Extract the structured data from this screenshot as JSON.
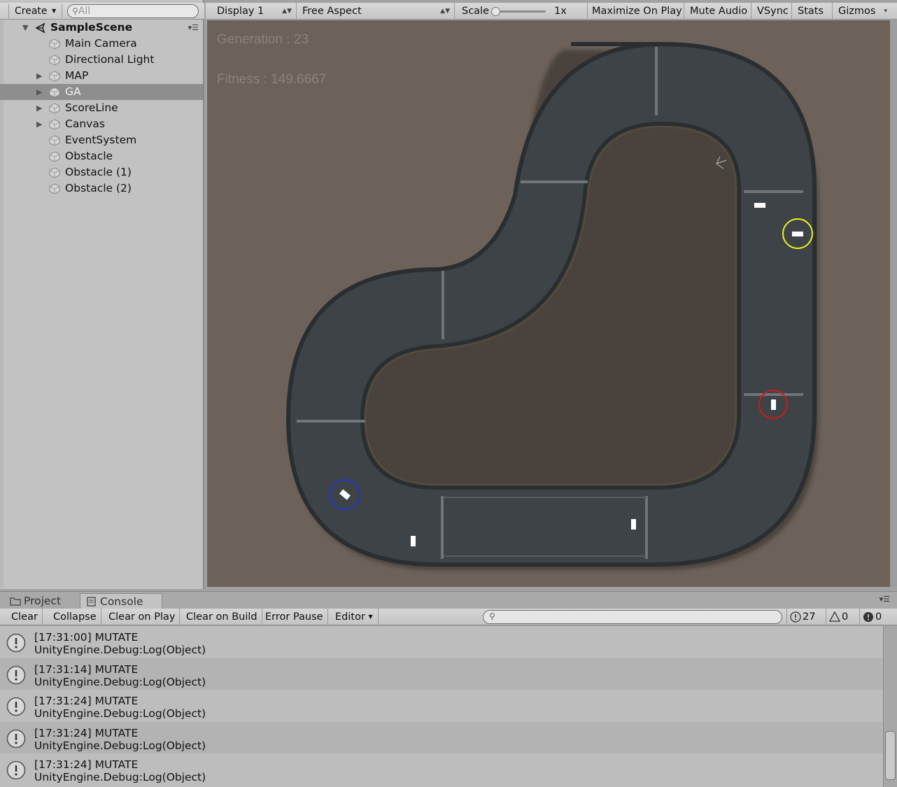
{
  "hierarchy": {
    "create_label": "Create",
    "search_placeholder": "All",
    "scene_name": "SampleScene",
    "items": [
      {
        "label": "Main Camera",
        "expandable": false
      },
      {
        "label": "Directional Light",
        "expandable": false
      },
      {
        "label": "MAP",
        "expandable": true
      },
      {
        "label": "GA",
        "expandable": true,
        "selected": true
      },
      {
        "label": "ScoreLine",
        "expandable": true
      },
      {
        "label": "Canvas",
        "expandable": true
      },
      {
        "label": "EventSystem",
        "expandable": false
      },
      {
        "label": "Obstacle",
        "expandable": false
      },
      {
        "label": "Obstacle (1)",
        "expandable": false
      },
      {
        "label": "Obstacle (2)",
        "expandable": false
      }
    ]
  },
  "game_toolbar": {
    "display": "Display 1",
    "aspect": "Free Aspect",
    "scale_label": "Scale",
    "scale_value": "1x",
    "maximize": "Maximize On Play",
    "mute": "Mute Audio",
    "vsync": "VSync",
    "stats": "Stats",
    "gizmos": "Gizmos"
  },
  "game_view": {
    "generation_text": "Generation : 23",
    "fitness_text": "Fitness : 149.6667",
    "colors": {
      "background": "#6c625a",
      "track": "#3d4347",
      "track_edge": "#2e3133",
      "highlight_yellow": "#f2f21e",
      "highlight_red": "#d21a1a",
      "highlight_blue": "#2036c8"
    }
  },
  "bottom_panel": {
    "tabs": [
      {
        "label": "Project",
        "active": false,
        "icon": "folder-icon"
      },
      {
        "label": "Console",
        "active": true,
        "icon": "console-icon"
      }
    ],
    "console_toolbar": {
      "clear": "Clear",
      "collapse": "Collapse",
      "clear_on_play": "Clear on Play",
      "clear_on_build": "Clear on Build",
      "error_pause": "Error Pause",
      "editor": "Editor",
      "info_count": "27",
      "warning_count": "0",
      "error_count": "0"
    },
    "log_entries": [
      {
        "line1": "[17:31:00] MUTATE",
        "line2": "UnityEngine.Debug:Log(Object)"
      },
      {
        "line1": "[17:31:14] MUTATE",
        "line2": "UnityEngine.Debug:Log(Object)"
      },
      {
        "line1": "[17:31:24] MUTATE",
        "line2": "UnityEngine.Debug:Log(Object)"
      },
      {
        "line1": "[17:31:24] MUTATE",
        "line2": "UnityEngine.Debug:Log(Object)"
      },
      {
        "line1": "[17:31:24] MUTATE",
        "line2": "UnityEngine.Debug:Log(Object)"
      }
    ]
  }
}
